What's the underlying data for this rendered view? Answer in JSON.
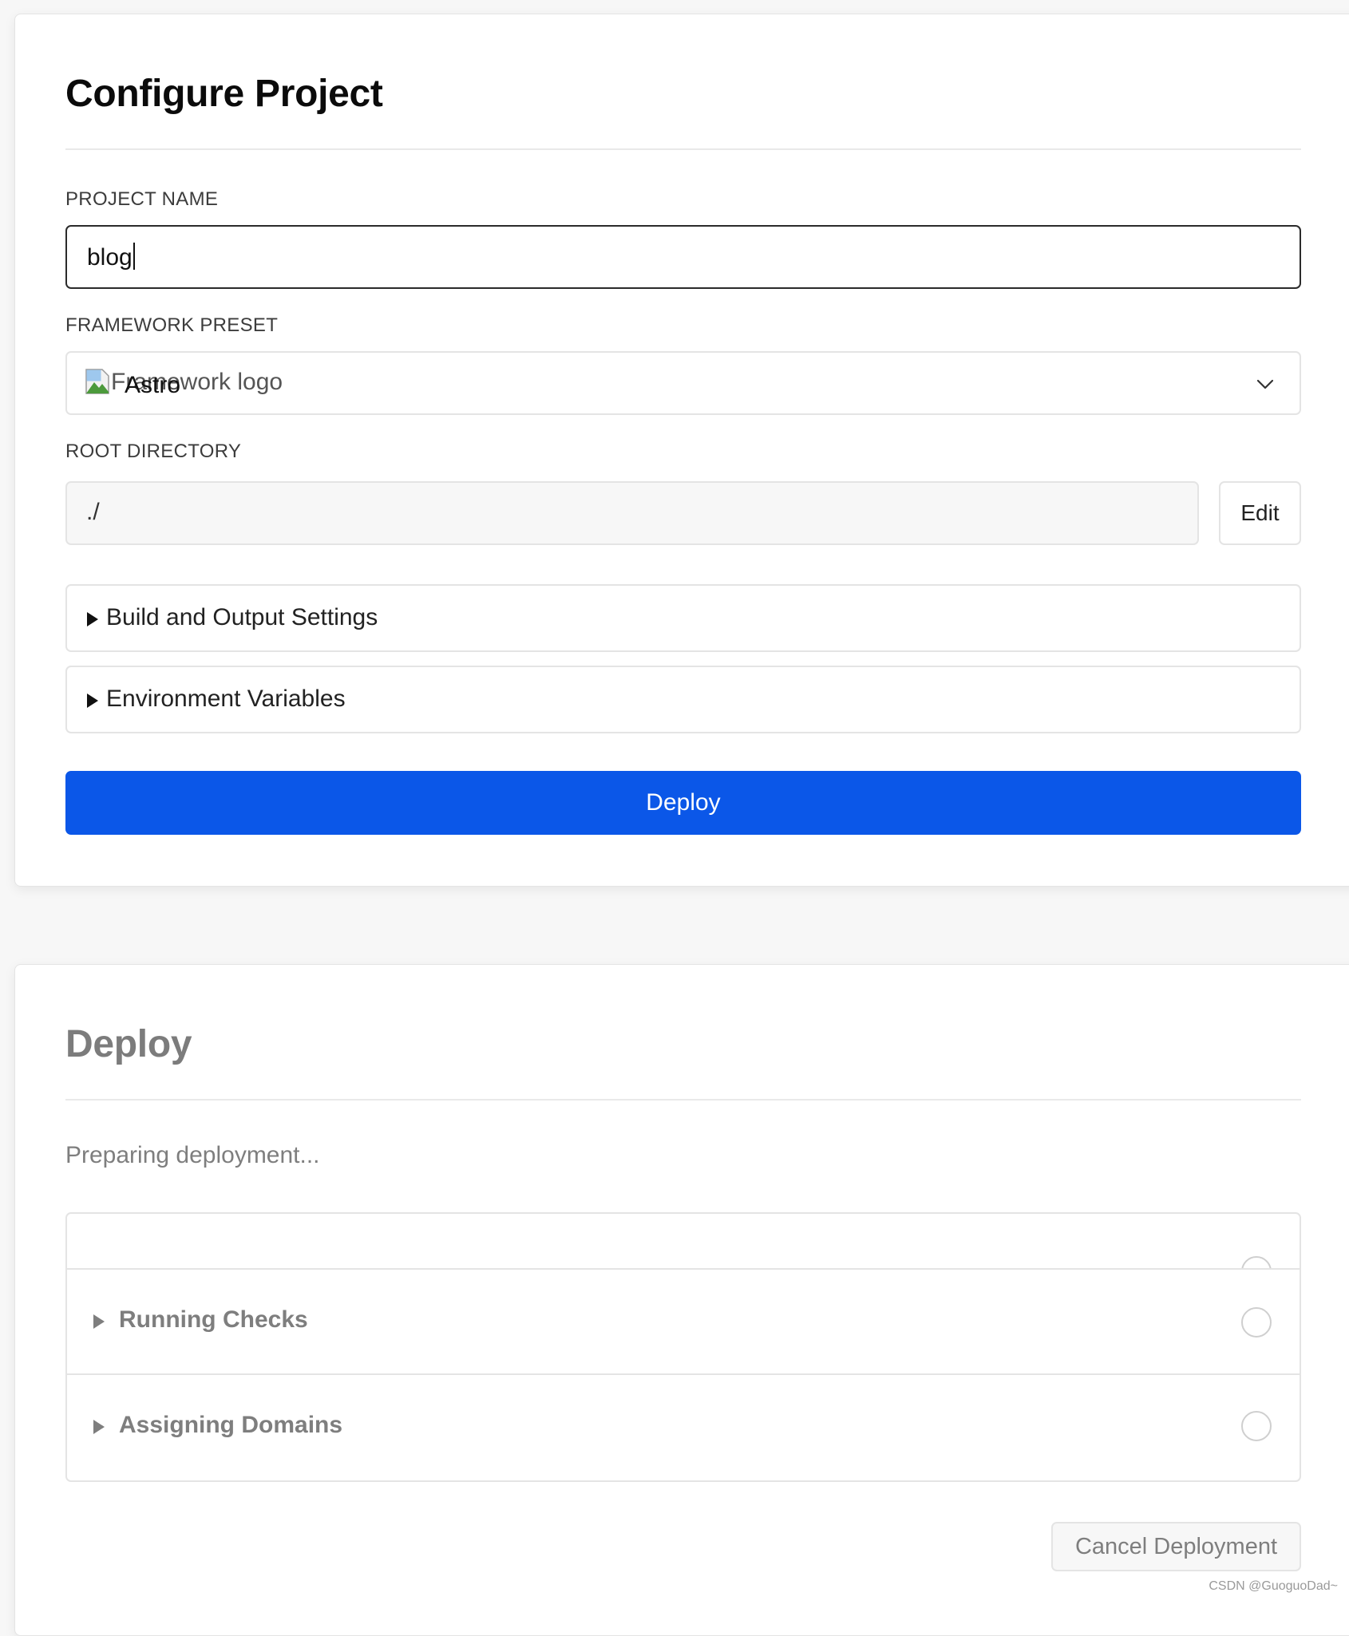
{
  "configure": {
    "title": "Configure Project",
    "project_name": {
      "label": "PROJECT NAME",
      "value": "blog"
    },
    "framework_preset": {
      "label": "FRAMEWORK PRESET",
      "logo_alt": "Framework logo",
      "selected": "Astro",
      "icon": "chevron-down-icon"
    },
    "root_directory": {
      "label": "ROOT DIRECTORY",
      "value": "./",
      "edit_label": "Edit"
    },
    "sections": [
      {
        "label": "Build and Output Settings"
      },
      {
        "label": "Environment Variables"
      }
    ],
    "deploy_label": "Deploy",
    "accent_color": "#0b57e8"
  },
  "deploy": {
    "title": "Deploy",
    "status": "Preparing deployment...",
    "steps": [
      {
        "label": ""
      },
      {
        "label": "Running Checks"
      },
      {
        "label": "Assigning Domains"
      }
    ],
    "cancel_label": "Cancel Deployment"
  },
  "watermark": "CSDN @GuoguoDad~"
}
